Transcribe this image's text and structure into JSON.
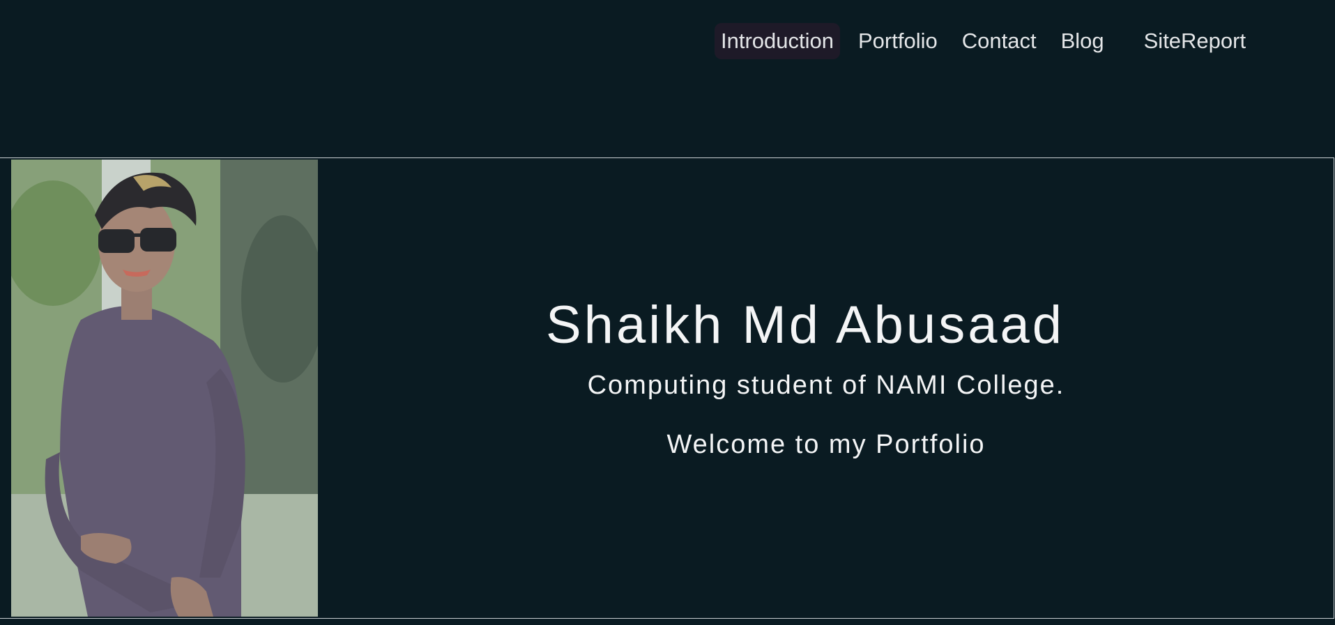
{
  "nav": {
    "items": [
      {
        "label": "Introduction",
        "active": true
      },
      {
        "label": "Portfolio",
        "active": false
      },
      {
        "label": "Contact",
        "active": false
      },
      {
        "label": "Blog",
        "active": false
      },
      {
        "label": "SiteReport",
        "active": false
      }
    ]
  },
  "hero": {
    "photo_icon": "profile-photo",
    "name": "Shaikh Md Abusaad",
    "tagline": "Computing student of NAMI College.",
    "welcome": "Welcome to my Portfolio"
  },
  "colors": {
    "background": "#0a1b22",
    "text": "#f4f5f6",
    "active_nav_bg": "#1e1a28",
    "border": "#c9ced1"
  }
}
